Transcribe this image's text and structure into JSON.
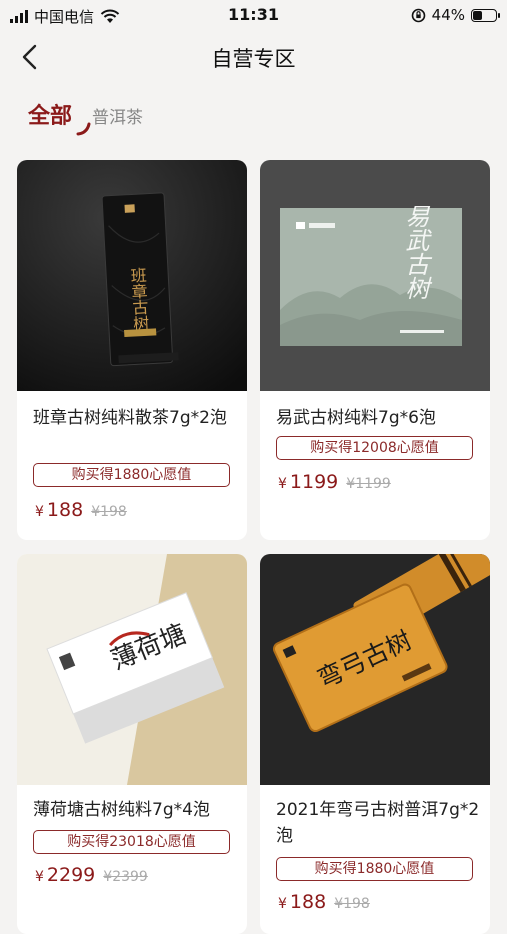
{
  "status": {
    "carrier": "中国电信",
    "time": "11:31",
    "battery": "44%",
    "battery_fraction": 0.44
  },
  "nav": {
    "title": "自营专区"
  },
  "tabs": [
    {
      "label": "全部"
    },
    {
      "label": "普洱茶"
    }
  ],
  "products": [
    {
      "title": "班章古树纯料散茶7g*2泡",
      "badge": "购买得1880心愿值",
      "currency": "¥",
      "price": "188",
      "original": "¥198",
      "image_text": "班章古树"
    },
    {
      "title": "易武古树纯料7g*6泡",
      "badge": "购买得12008心愿值",
      "currency": "¥",
      "price": "1199",
      "original": "¥1199",
      "image_text": "易武古树"
    },
    {
      "title": "薄荷塘古树纯料7g*4泡",
      "badge": "购买得23018心愿值",
      "currency": "¥",
      "price": "2299",
      "original": "¥2399",
      "image_text": "薄荷塘"
    },
    {
      "title": "2021年弯弓古树普洱7g*2泡",
      "badge": "购买得1880心愿值",
      "currency": "¥",
      "price": "188",
      "original": "¥198",
      "image_text": "弯弓古树"
    }
  ]
}
